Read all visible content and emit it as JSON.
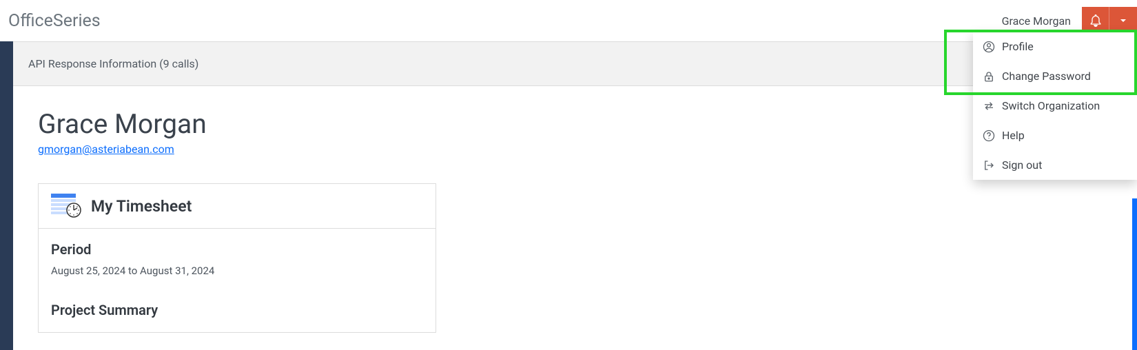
{
  "header": {
    "brand": "OfficeSeries",
    "user_name": "Grace Morgan"
  },
  "banner": {
    "api_info": "API Response Information (9 calls)"
  },
  "profile": {
    "display_name": "Grace Morgan",
    "email": "gmorgan@asteriabean.com"
  },
  "timesheet_card": {
    "title": "My Timesheet",
    "period_label": "Period",
    "period_value": "August 25, 2024 to August 31, 2024",
    "summary_label": "Project Summary"
  },
  "user_menu": {
    "items": [
      "Profile",
      "Change Password",
      "Switch Organization",
      "Help",
      "Sign out"
    ]
  }
}
